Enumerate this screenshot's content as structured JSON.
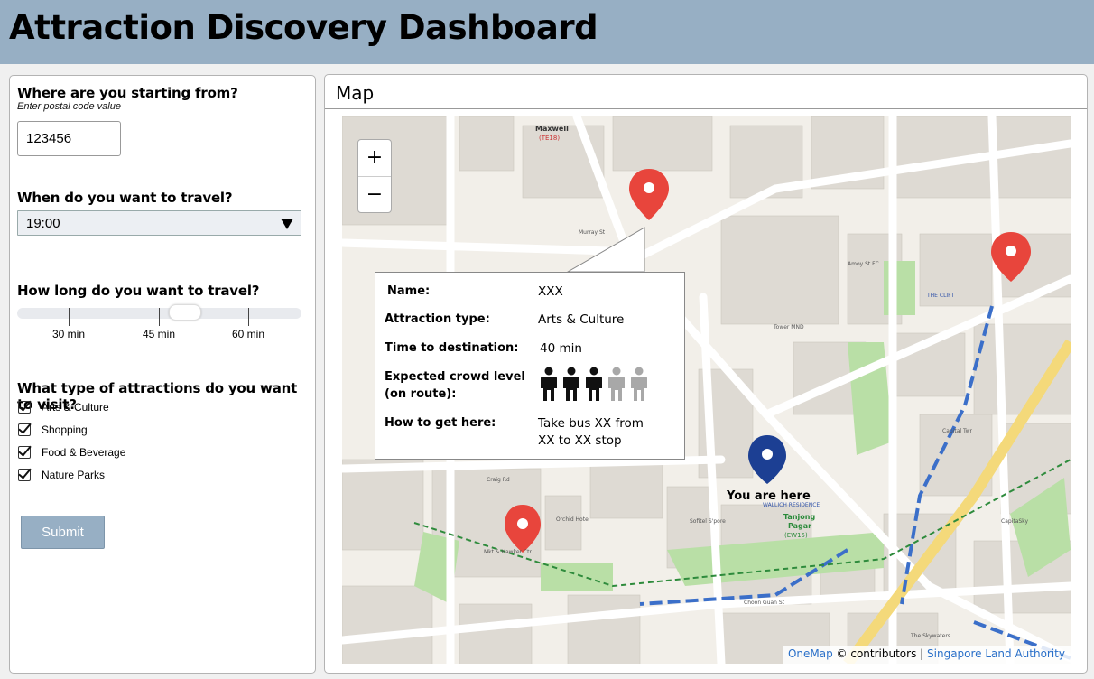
{
  "header": {
    "title": "Attraction Discovery Dashboard"
  },
  "form": {
    "start_question": "Where are you starting from?",
    "start_hint": "Enter postal code value",
    "postal_value": "123456",
    "time_question": "When do you want to travel?",
    "time_value": "19:00",
    "duration_question": "How long do you want to travel?",
    "duration_ticks": [
      "30 min",
      "45 min",
      "60 min"
    ],
    "duration_value": "45 min",
    "types_question": "What type of attractions do you want to visit?",
    "types": [
      {
        "label": "Arts & Culture",
        "checked": true
      },
      {
        "label": "Shopping",
        "checked": true
      },
      {
        "label": "Food & Beverage",
        "checked": true
      },
      {
        "label": "Nature Parks",
        "checked": true
      }
    ],
    "submit_label": "Submit"
  },
  "map": {
    "title": "Map",
    "zoom_in": "+",
    "zoom_out": "−",
    "you_are_here": "You are here",
    "popup": {
      "name_label": "Name:",
      "name_value": "XXX",
      "type_label": "Attraction type:",
      "type_value": "Arts & Culture",
      "time_label": "Time to destination:",
      "time_value": "40 min",
      "crowd_label_1": "Expected crowd level",
      "crowd_label_2": "(on route):",
      "crowd_level": 3,
      "crowd_max": 5,
      "route_label": "How to get here:",
      "route_value_1": "Take bus XX from",
      "route_value_2": "XX to XX stop"
    },
    "attribution": {
      "brand": "OneMap",
      "contrib": "© contributors |",
      "authority": "Singapore Land Authority"
    },
    "labels": {
      "maxwell": "Maxwell",
      "maxwell_code": "(TE18)",
      "tanjong": "Tanjong",
      "pagar": "Pagar",
      "ew": "(EW15)",
      "wallich": "WALLICH RESIDENCE",
      "sofitel": "Sofitel S'pore City Ctr",
      "annex": "Annex",
      "amoy": "Amoy St FC",
      "tower": "Tower MND Blk Complex",
      "capital": "Capital Twr",
      "capitasky": "CapitaSky",
      "clift": "THE CLIFT",
      "orchid": "Orchid Hotel",
      "craig": "Craig Rd",
      "murray": "Murray St",
      "choon": "Choon Guan St",
      "anson": "Anson Rd",
      "robinson": "Robinson Rd",
      "cecil": "Cecil St",
      "kadayanallur": "Kadayanallur St",
      "skywaters": "The Skywaters",
      "mkt": "Mkt & Hawker Ctr"
    },
    "colors": {
      "pin_red": "#e8453c",
      "pin_blue": "#1c3f93",
      "road": "#ffffff",
      "block": "#dcd8d2",
      "green": "#b9dfa6",
      "water_line": "#3b6fc9"
    }
  }
}
